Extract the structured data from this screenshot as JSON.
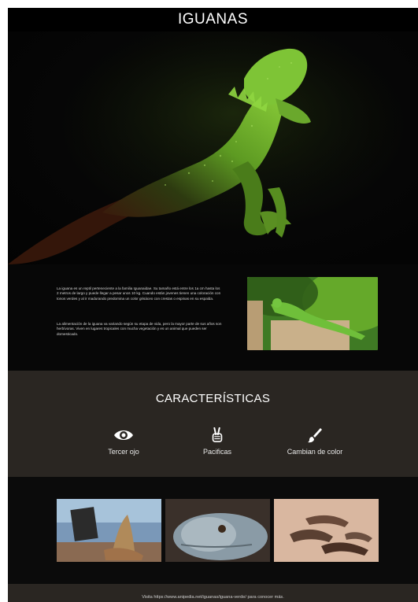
{
  "header": {
    "title": "IGUANAS"
  },
  "intro": {
    "paragraph1": "La iguana es un reptil perteneciente a la familia Iguanaidae. Su tamaño está entre los 1a cm hasta los 2 metros de largo y puede llegar a pesar unos 10 kg. Cuando están jovenes tienen una coloración con tonos verdes y al ir madurando predomina un color grisáceo con crestas o espinas en su espalda.",
    "paragraph2": "La alimentación de la iguana va variando según su etapa de vida, pero la mayor parte de sus años son herbívoras. Viven en lugares tropicales con mucha vegetación y es un animal que pueden ser domesticado."
  },
  "characteristics": {
    "title": "CARACTERÍSTICAS",
    "items": [
      {
        "label": "Tercer ojo",
        "icon": "eye-icon"
      },
      {
        "label": "Pacificas",
        "icon": "peace-hand-icon"
      },
      {
        "label": "Cambian de color",
        "icon": "paint-brush-icon"
      }
    ]
  },
  "footer": {
    "text": "Visita https://www.anipedia.net/iguanas/iguana-verde/ para conocer más."
  },
  "colors": {
    "page_bg": "#0b0b0b",
    "band_bg": "#2a2622",
    "header_bg": "#000000",
    "iguana_green": "#6fb52c"
  }
}
